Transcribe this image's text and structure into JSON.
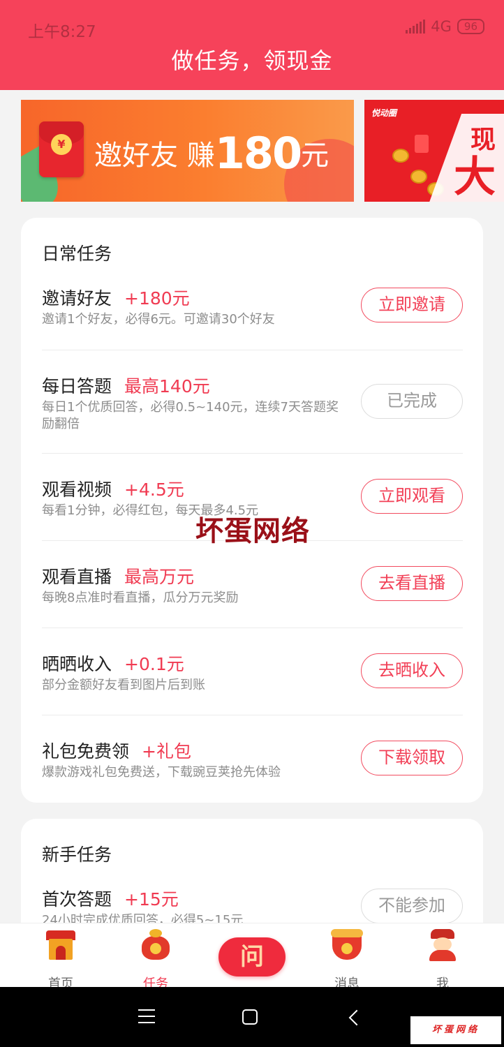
{
  "status_bar": {
    "time": "上午8:27",
    "network": "4G",
    "battery": "96"
  },
  "header": {
    "title": "做任务，领现金"
  },
  "banner_main": {
    "text_prefix": "邀好友 赚",
    "amount": "180",
    "unit": "元"
  },
  "banner_side": {
    "brand": "悦动圈",
    "word1": "现",
    "word2": "大"
  },
  "daily": {
    "title": "日常任务",
    "tasks": [
      {
        "name": "邀请好友",
        "reward": "+180元",
        "desc": "邀请1个好友，必得6元。可邀请30个好友",
        "button": "立即邀请",
        "done": false
      },
      {
        "name": "每日答题",
        "reward": "最高140元",
        "desc": "每日1个优质回答，必得0.5~140元，连续7天答题奖励翻倍",
        "button": "已完成",
        "done": true
      },
      {
        "name": "观看视频",
        "reward": "+4.5元",
        "desc": "每看1分钟，必得红包，每天最多4.5元",
        "button": "立即观看",
        "done": false
      },
      {
        "name": "观看直播",
        "reward": "最高万元",
        "desc": "每晚8点准时看直播，瓜分万元奖励",
        "button": "去看直播",
        "done": false
      },
      {
        "name": "晒晒收入",
        "reward": "+0.1元",
        "desc": "部分金额好友看到图片后到账",
        "button": "去晒收入",
        "done": false
      },
      {
        "name": "礼包免费领",
        "reward": "+礼包",
        "desc": "爆款游戏礼包免费送，下载豌豆荚抢先体验",
        "button": "下载领取",
        "done": false
      }
    ]
  },
  "newbie": {
    "title": "新手任务",
    "tasks": [
      {
        "name": "首次答题",
        "reward": "+15元",
        "desc": "24小时完成优质回答，必得5~15元",
        "button": "不能参加",
        "done": true
      }
    ]
  },
  "watermark": "坏蛋网络",
  "tabbar": {
    "items": [
      {
        "label": "首页",
        "icon": "home-icon",
        "active": false
      },
      {
        "label": "任务",
        "icon": "money-bag-icon",
        "active": true
      },
      {
        "label": "问",
        "icon": "ask-icon",
        "active": false
      },
      {
        "label": "消息",
        "icon": "message-icon",
        "active": false
      },
      {
        "label": "我",
        "icon": "profile-icon",
        "active": false
      }
    ]
  },
  "corner_mark": "坏蛋网络",
  "colors": {
    "brand": "#f6425a",
    "reward": "#f03b52"
  }
}
